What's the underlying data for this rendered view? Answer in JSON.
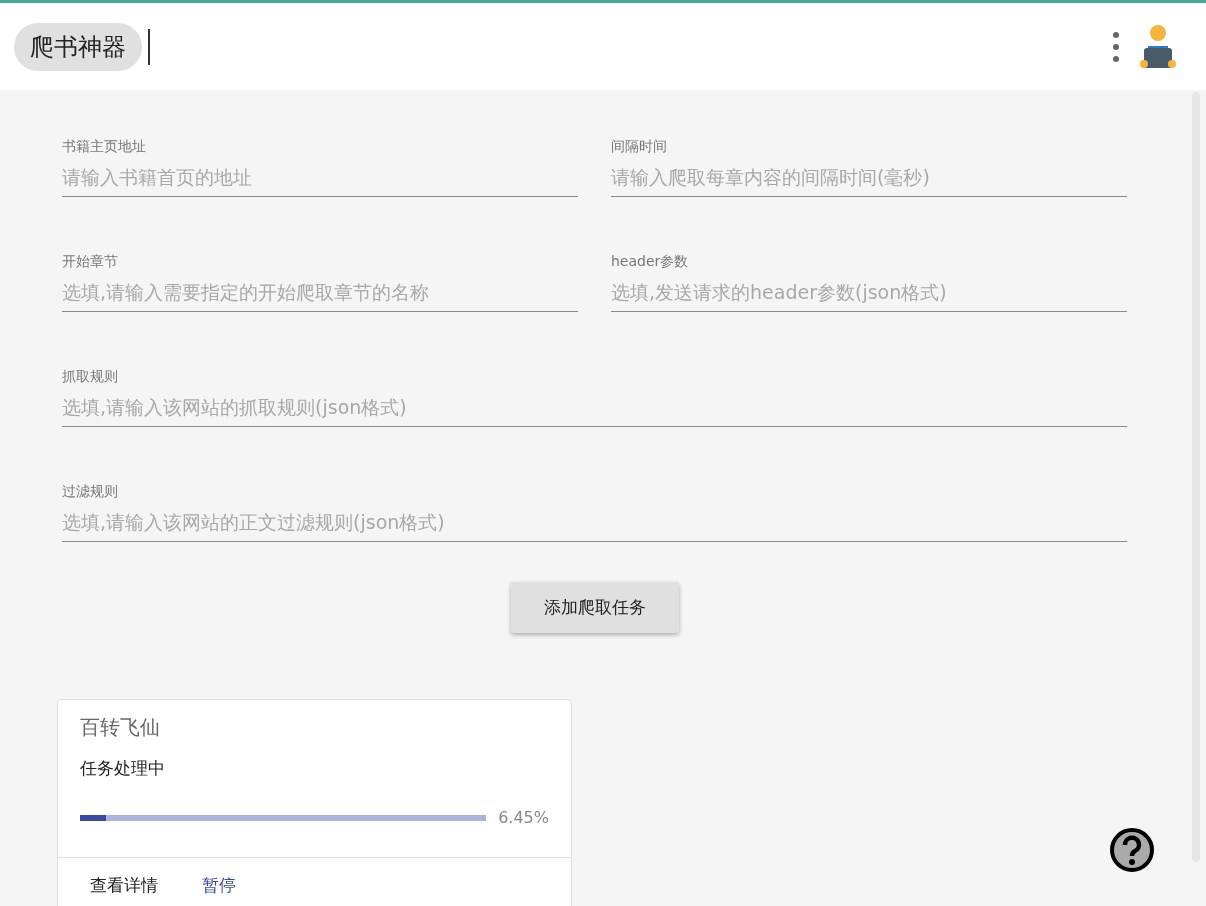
{
  "app_bar": {
    "title": "爬书神器"
  },
  "form": {
    "fields": [
      {
        "label": "书籍主页地址",
        "placeholder": "请输入书籍首页的地址",
        "wide": false
      },
      {
        "label": "间隔时间",
        "placeholder": "请输入爬取每章内容的间隔时间(毫秒)",
        "wide": false
      },
      {
        "label": "开始章节",
        "placeholder": "选填,请输入需要指定的开始爬取章节的名称",
        "wide": false
      },
      {
        "label": "header参数",
        "placeholder": "选填,发送请求的header参数(json格式)",
        "wide": false
      },
      {
        "label": "抓取规则",
        "placeholder": "选填,请输入该网站的抓取规则(json格式)",
        "wide": true
      },
      {
        "label": "过滤规则",
        "placeholder": "选填,请输入该网站的正文过滤规则(json格式)",
        "wide": true
      }
    ],
    "submit": "添加爬取任务"
  },
  "tasks": [
    {
      "title": "百转飞仙",
      "status": "任务处理中",
      "level": 0.0645,
      "reading": "6.45%",
      "actions": [
        "查看详情",
        "暂停"
      ]
    }
  ]
}
